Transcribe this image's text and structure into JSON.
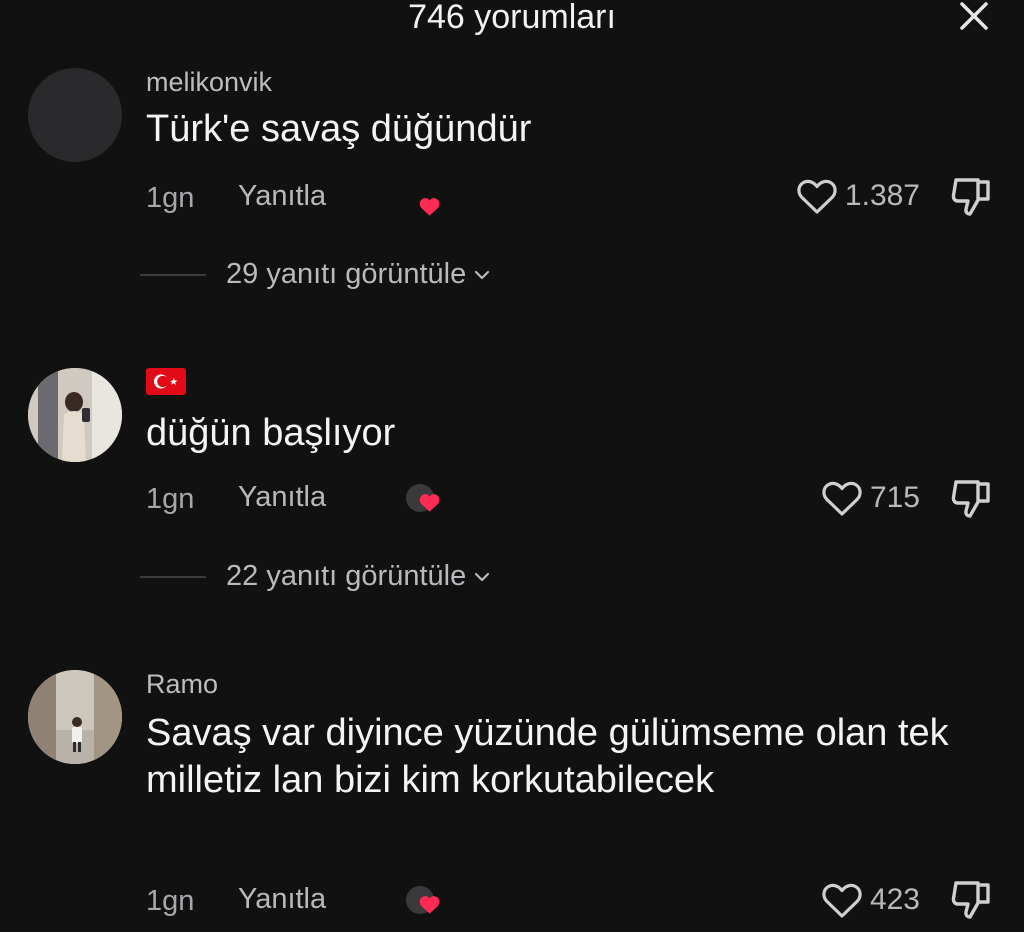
{
  "header": {
    "title": "746 yorumları"
  },
  "comments": [
    {
      "username": "melikonvik",
      "text": "Türk'e savaş düğündür",
      "time": "1gn",
      "reply_label": "Yanıtla",
      "likes": "1.387",
      "view_replies": "29 yanıtı görüntüle"
    },
    {
      "username": "",
      "text": "düğün başlıyor",
      "time": "1gn",
      "reply_label": "Yanıtla",
      "likes": "715",
      "view_replies": "22 yanıtı görüntüle"
    },
    {
      "username": "Ramo",
      "text": "Savaş var diyince yüzünde gülümseme olan tek milletiz lan bizi kim korkutabilecek",
      "time": "1gn",
      "reply_label": "Yanıtla",
      "likes": "423"
    }
  ],
  "icons": {
    "close": "close-icon",
    "like": "heart-outline-icon",
    "dislike": "thumbs-down-icon",
    "creator_liked": "creator-heart-icon",
    "flag": "turkey-flag-icon",
    "chevron": "chevron-down-icon"
  },
  "colors": {
    "background": "#121112",
    "accent_heart": "#fe2c55",
    "flag_red": "#e30a17"
  }
}
